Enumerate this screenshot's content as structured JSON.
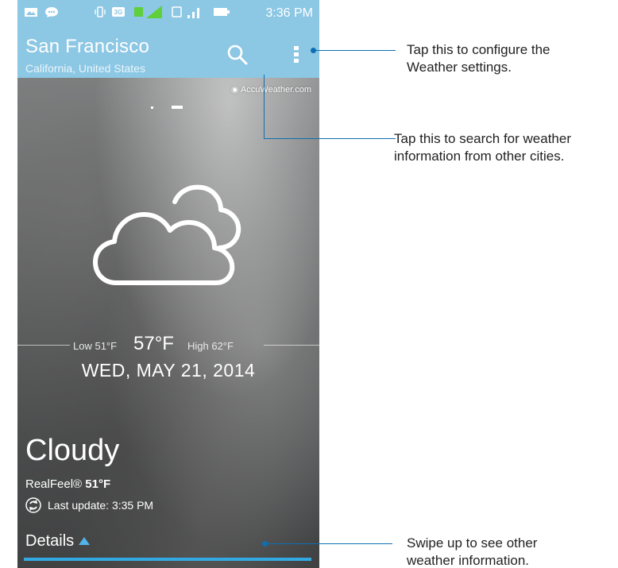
{
  "status_bar": {
    "time": "3:36 PM",
    "icons": [
      "gallery-icon",
      "chat-icon",
      "vibrate-icon",
      "3g-icon",
      "sim1-signal-icon",
      "sim2-signal-icon",
      "battery-icon"
    ],
    "background": "#8cc7e4"
  },
  "header": {
    "city": "San Francisco",
    "region": "California, United States",
    "search_icon": "search-icon",
    "menu_icon": "more-vertical-icon"
  },
  "source": "AccuWeather.com",
  "weather": {
    "icon": "cloudy-icon",
    "low": "Low 51°F",
    "current": "57°F",
    "high": "High 62°F",
    "date": "WED, MAY 21, 2014",
    "condition": "Cloudy",
    "realfeel_label": "RealFeel®",
    "realfeel_value": "51°F",
    "last_update": "Last update: 3:35 PM",
    "details_label": "Details"
  },
  "annotations": {
    "settings": [
      "Tap this to configure the",
      "Weather settings."
    ],
    "search": [
      "Tap this to search for weather",
      "information from other cities."
    ],
    "details": [
      "Swipe up to see other",
      "weather information."
    ]
  },
  "colors": {
    "accent": "#33a9e3",
    "callout": "#0d6fb2"
  }
}
